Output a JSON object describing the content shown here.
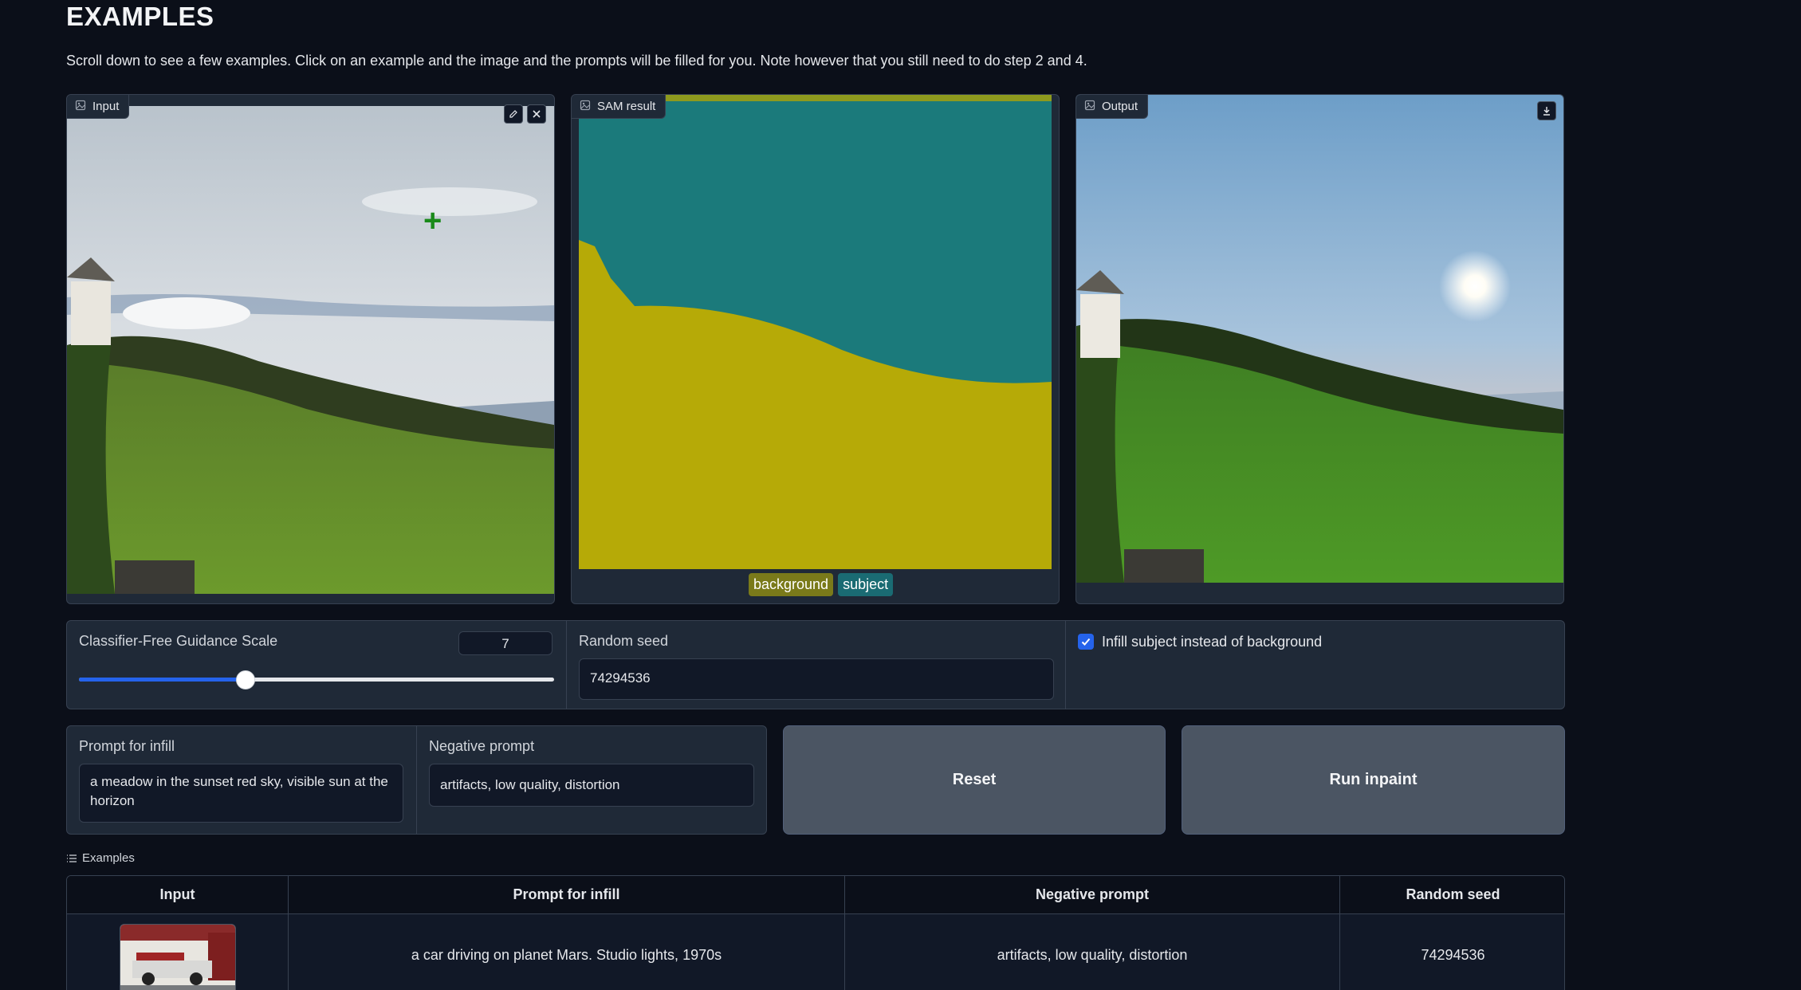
{
  "header": {
    "title": "EXAMPLES",
    "description": "Scroll down to see a few examples. Click on an example and the image and the prompts will be filled for you. Note however that you still need to do step 2 and 4."
  },
  "panels": {
    "input": {
      "label": "Input",
      "icon": "image-icon",
      "actions": [
        "edit-icon",
        "close-icon"
      ]
    },
    "sam": {
      "label": "SAM result",
      "icon": "image-icon",
      "legend": [
        "background",
        "subject"
      ]
    },
    "output": {
      "label": "Output",
      "icon": "image-icon",
      "actions": [
        "download-icon"
      ]
    }
  },
  "controls": {
    "cfg_label": "Classifier-Free Guidance Scale",
    "cfg_value": "7",
    "cfg_fraction": 0.35,
    "seed_label": "Random seed",
    "seed_value": "74294536",
    "infill_subject_label": "Infill subject instead of background",
    "infill_subject_checked": true
  },
  "prompts": {
    "infill_label": "Prompt for infill",
    "infill_value": "a meadow in the sunset red sky, visible sun at the horizon",
    "negative_label": "Negative prompt",
    "negative_value": "artifacts, low quality, distortion"
  },
  "buttons": {
    "reset": "Reset",
    "run": "Run inpaint"
  },
  "examples": {
    "label": "Examples",
    "headers": [
      "Input",
      "Prompt for infill",
      "Negative prompt",
      "Random seed"
    ],
    "rows": [
      {
        "prompt": "a car driving on planet Mars. Studio lights, 1970s",
        "negative": "artifacts, low quality, distortion",
        "seed": "74294536"
      }
    ]
  },
  "colors": {
    "background": "#0b0f19",
    "panel": "#1f2937",
    "accent": "#2563eb",
    "legend_background": "#7a7a1a",
    "legend_subject": "#1a6b73"
  }
}
